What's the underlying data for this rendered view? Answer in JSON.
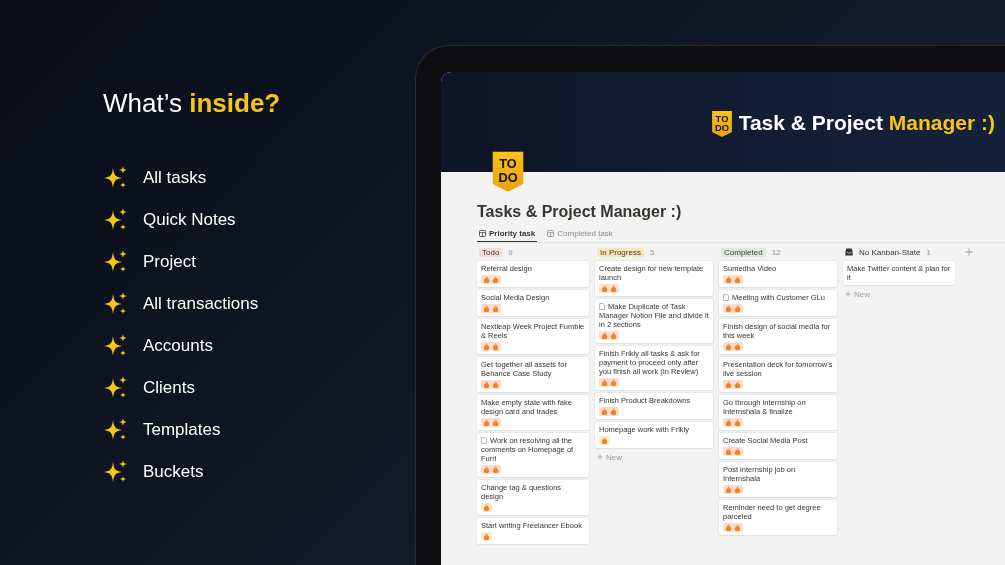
{
  "promo": {
    "heading": "What’s **inside?**",
    "features": [
      "All tasks",
      "Quick Notes",
      "Project",
      "All transactions",
      "Accounts",
      "Clients",
      "Templates",
      "Buckets"
    ]
  },
  "banner": {
    "logo_text": [
      "TO",
      "DO"
    ],
    "title": "Task & Project",
    "title_accent": "Manager :)"
  },
  "page": {
    "logo_text": [
      "TO",
      "DO"
    ],
    "title": "Tasks & Project Manager :)"
  },
  "tabs": [
    {
      "label": "Priority task",
      "selected": true
    },
    {
      "label": "Completed task",
      "selected": false
    }
  ],
  "board": {
    "columns": [
      {
        "label": "Todo",
        "count": "9",
        "kind": "pill",
        "color": "#f7d9d6",
        "cards": [
          {
            "title": "Referral design",
            "doc": false,
            "kind": "high"
          },
          {
            "title": "Social Media Design",
            "doc": false,
            "kind": "high"
          },
          {
            "title": "Nextleap Week Project Fumble & Reels",
            "doc": false,
            "kind": "high"
          },
          {
            "title": "Get together all assets for Behance Case Study",
            "doc": false,
            "kind": "high"
          },
          {
            "title": "Make empty state with fake design card and trades",
            "doc": false,
            "kind": "high"
          },
          {
            "title": "Work on resolving all the comments on Homepage of Furrl",
            "doc": true,
            "kind": "high"
          },
          {
            "title": "Change tag & questions design",
            "doc": false,
            "kind": "medium"
          },
          {
            "title": "Start writing Freelancer Ebook",
            "doc": false,
            "kind": "medium"
          }
        ]
      },
      {
        "label": "In Progress",
        "count": "5",
        "kind": "pill",
        "color": "#f8e5b9",
        "new_label": "New",
        "cards": [
          {
            "title": "Create design for new template launch",
            "doc": false,
            "kind": "high"
          },
          {
            "title": "Make Duplicate of Task Manager Notion File and divide it in 2 sections",
            "doc": true,
            "kind": "high"
          },
          {
            "title": "Finish Frikly all tasks & ask for payment to proceed only after you finish all work (In Review)",
            "doc": false,
            "kind": "high"
          },
          {
            "title": "Finish Product Breakdowns",
            "doc": false,
            "kind": "high"
          },
          {
            "title": "Homepage work with Frikly",
            "doc": false,
            "kind": "medium"
          }
        ]
      },
      {
        "label": "Completed",
        "count": "12",
        "kind": "pill",
        "color": "#d9ecd9",
        "cards": [
          {
            "title": "Sumedha Video",
            "doc": false,
            "kind": "high"
          },
          {
            "title": "Meeting with Customer GLu",
            "doc": true,
            "kind": "high"
          },
          {
            "title": "Finish design of social media for this week",
            "doc": false,
            "kind": "high"
          },
          {
            "title": "Presentation deck for tomorrow's live session",
            "doc": false,
            "kind": "high"
          },
          {
            "title": "Go through internship on Internshala & finalize",
            "doc": false,
            "kind": "high"
          },
          {
            "title": "Create Social Media Post",
            "doc": false,
            "kind": "high"
          },
          {
            "title": "Post internship job on Internshala",
            "doc": false,
            "kind": "high"
          },
          {
            "title": "Reminder need to get degree parceled",
            "doc": false,
            "kind": "high"
          }
        ]
      },
      {
        "label": "No Kanban-State",
        "count": "1",
        "kind": "inbox",
        "new_label": "New",
        "cards": [
          {
            "title": "Make Twitter content & plan for it",
            "doc": false,
            "kind": "plain"
          }
        ]
      }
    ]
  }
}
